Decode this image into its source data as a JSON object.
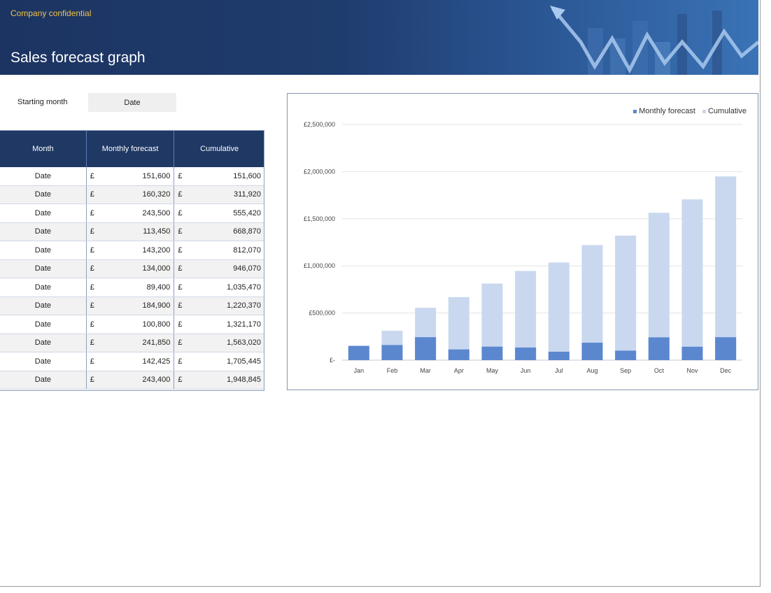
{
  "header": {
    "confidential": "Company confidential",
    "title": "Sales forecast graph"
  },
  "starting_month": {
    "label": "Starting month",
    "value": "Date"
  },
  "table": {
    "headers": [
      "Month",
      "Monthly forecast",
      "Cumulative"
    ],
    "currency": "£",
    "rows": [
      {
        "month": "Date",
        "monthly": "151,600",
        "cumulative": "151,600"
      },
      {
        "month": "Date",
        "monthly": "160,320",
        "cumulative": "311,920"
      },
      {
        "month": "Date",
        "monthly": "243,500",
        "cumulative": "555,420"
      },
      {
        "month": "Date",
        "monthly": "113,450",
        "cumulative": "668,870"
      },
      {
        "month": "Date",
        "monthly": "143,200",
        "cumulative": "812,070"
      },
      {
        "month": "Date",
        "monthly": "134,000",
        "cumulative": "946,070"
      },
      {
        "month": "Date",
        "monthly": "89,400",
        "cumulative": "1,035,470"
      },
      {
        "month": "Date",
        "monthly": "184,900",
        "cumulative": "1,220,370"
      },
      {
        "month": "Date",
        "monthly": "100,800",
        "cumulative": "1,321,170"
      },
      {
        "month": "Date",
        "monthly": "241,850",
        "cumulative": "1,563,020"
      },
      {
        "month": "Date",
        "monthly": "142,425",
        "cumulative": "1,705,445"
      },
      {
        "month": "Date",
        "monthly": "243,400",
        "cumulative": "1,948,845"
      }
    ]
  },
  "colors": {
    "header_bg": "#1f3864",
    "monthly": "#5b87cf",
    "cumulative": "#c9d8ef",
    "confidential_text": "#f2c24b"
  },
  "chart_data": {
    "type": "bar",
    "categories": [
      "Jan",
      "Feb",
      "Mar",
      "Apr",
      "May",
      "Jun",
      "Jul",
      "Aug",
      "Sep",
      "Oct",
      "Nov",
      "Dec"
    ],
    "series": [
      {
        "name": "Monthly forecast",
        "values": [
          151600,
          160320,
          243500,
          113450,
          143200,
          134000,
          89400,
          184900,
          100800,
          241850,
          142425,
          243400
        ]
      },
      {
        "name": "Cumulative",
        "values": [
          151600,
          311920,
          555420,
          668870,
          812070,
          946070,
          1035470,
          1220370,
          1321170,
          1563020,
          1705445,
          1948845
        ]
      }
    ],
    "yticks": [
      "£-",
      "£500,000",
      "£1,000,000",
      "£1,500,000",
      "£2,000,000",
      "£2,500,000"
    ],
    "ylim": [
      0,
      2500000
    ],
    "legend_position": "top-right",
    "grid": true
  }
}
